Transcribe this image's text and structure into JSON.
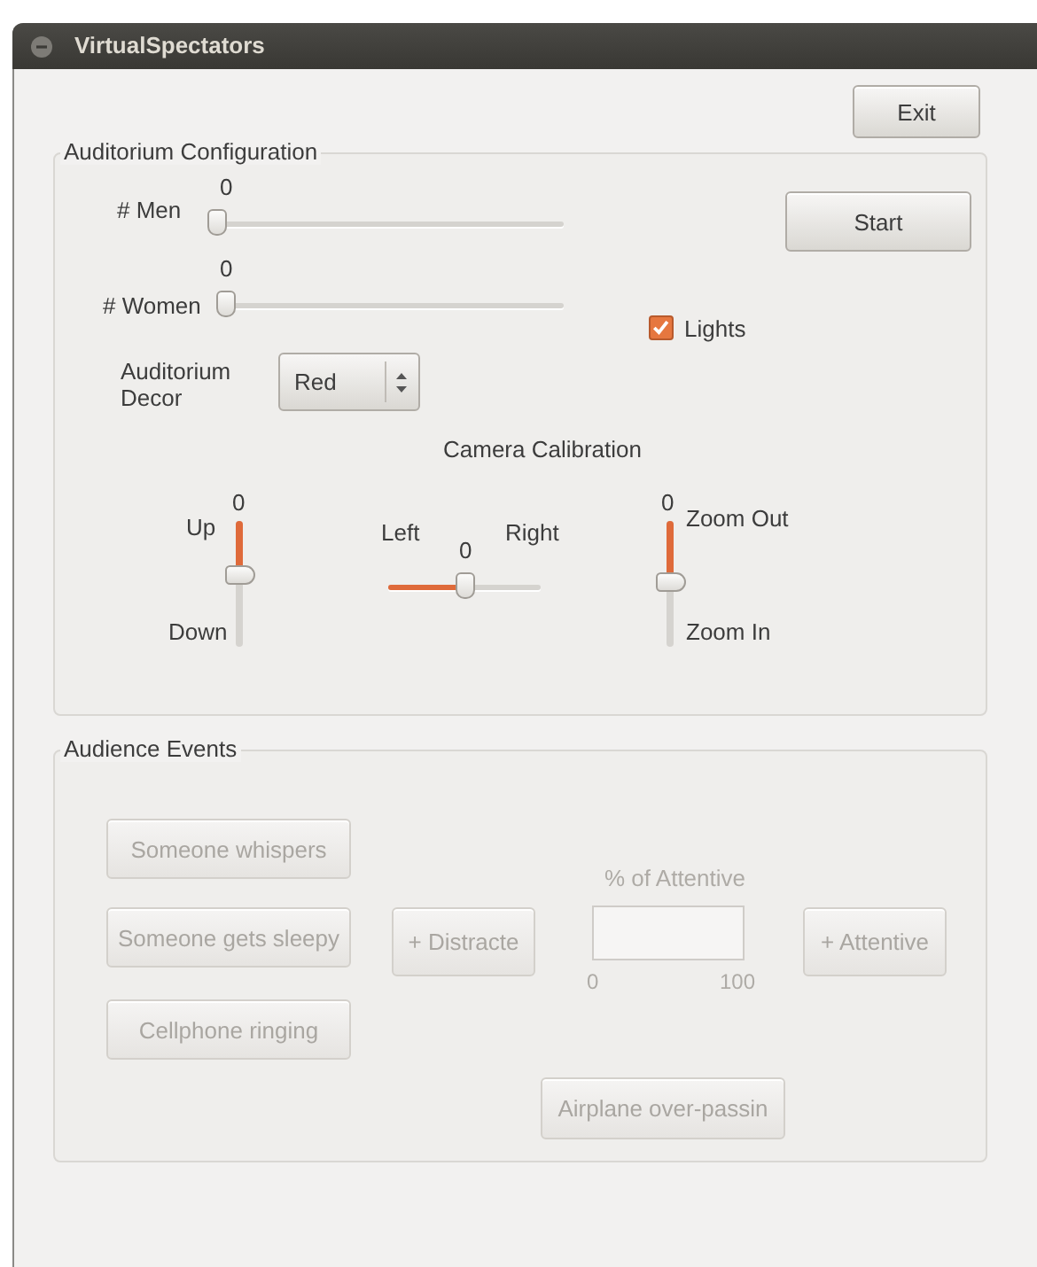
{
  "window": {
    "title": "VirtualSpectators"
  },
  "exit_button": {
    "label": "Exit"
  },
  "auditorium_configuration": {
    "title": "Auditorium Configuration",
    "sliders": [
      {
        "label": "# Men",
        "value": "0",
        "level": 0
      },
      {
        "label": "# Women",
        "value": "0",
        "level": 0
      }
    ],
    "start_button": {
      "label": "Start"
    },
    "lights": {
      "label": "Lights",
      "checked": true
    },
    "decor": {
      "label": "Auditorium Decor",
      "value": "Red"
    },
    "camera_calibration": {
      "title": "Camera Calibration",
      "sliders": [
        {
          "kind": "vertical",
          "start_label": "Up",
          "end_label": "Down",
          "value": "0",
          "level": 0.42
        },
        {
          "kind": "horizontal",
          "start_label": "Left",
          "end_label": "Right",
          "value": "0",
          "level": 0.5
        },
        {
          "kind": "vertical",
          "start_label": "Zoom Out",
          "end_label": "Zoom In",
          "value": "0",
          "level": 0.48
        }
      ]
    }
  },
  "audience_events": {
    "title": "Audience Events",
    "buttons": [
      {
        "label": "Someone whispers",
        "disabled": true
      },
      {
        "label": "Someone gets sleepy",
        "disabled": true
      },
      {
        "label": "Cellphone ringing",
        "disabled": true
      },
      {
        "label": "+ Distracte",
        "disabled": true
      },
      {
        "label": "+ Attentive",
        "disabled": true
      },
      {
        "label": "Airplane over-passin",
        "disabled": true
      }
    ],
    "attentive_meter": {
      "label": "% of Attentive",
      "min": "0",
      "max": "100",
      "level": 0,
      "disabled": true
    }
  }
}
